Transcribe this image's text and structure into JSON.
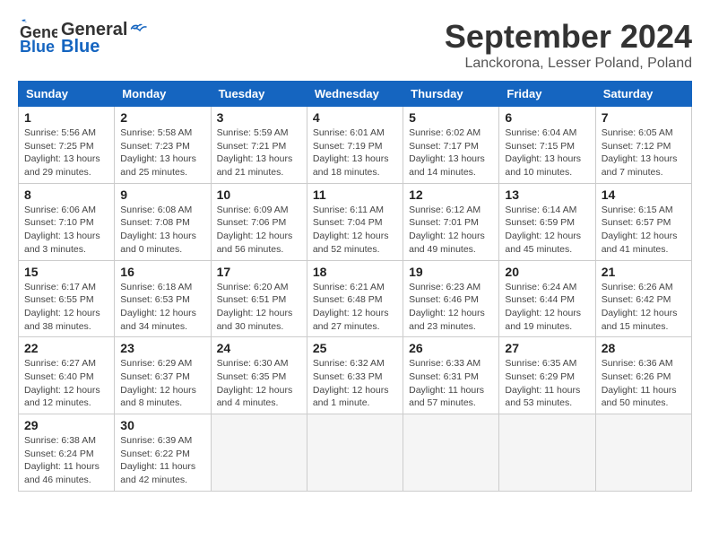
{
  "header": {
    "logo_general": "General",
    "logo_blue": "Blue",
    "month": "September 2024",
    "location": "Lanckorona, Lesser Poland, Poland"
  },
  "weekdays": [
    "Sunday",
    "Monday",
    "Tuesday",
    "Wednesday",
    "Thursday",
    "Friday",
    "Saturday"
  ],
  "weeks": [
    [
      {
        "day": "1",
        "info": "Sunrise: 5:56 AM\nSunset: 7:25 PM\nDaylight: 13 hours\nand 29 minutes."
      },
      {
        "day": "2",
        "info": "Sunrise: 5:58 AM\nSunset: 7:23 PM\nDaylight: 13 hours\nand 25 minutes."
      },
      {
        "day": "3",
        "info": "Sunrise: 5:59 AM\nSunset: 7:21 PM\nDaylight: 13 hours\nand 21 minutes."
      },
      {
        "day": "4",
        "info": "Sunrise: 6:01 AM\nSunset: 7:19 PM\nDaylight: 13 hours\nand 18 minutes."
      },
      {
        "day": "5",
        "info": "Sunrise: 6:02 AM\nSunset: 7:17 PM\nDaylight: 13 hours\nand 14 minutes."
      },
      {
        "day": "6",
        "info": "Sunrise: 6:04 AM\nSunset: 7:15 PM\nDaylight: 13 hours\nand 10 minutes."
      },
      {
        "day": "7",
        "info": "Sunrise: 6:05 AM\nSunset: 7:12 PM\nDaylight: 13 hours\nand 7 minutes."
      }
    ],
    [
      {
        "day": "8",
        "info": "Sunrise: 6:06 AM\nSunset: 7:10 PM\nDaylight: 13 hours\nand 3 minutes."
      },
      {
        "day": "9",
        "info": "Sunrise: 6:08 AM\nSunset: 7:08 PM\nDaylight: 13 hours\nand 0 minutes."
      },
      {
        "day": "10",
        "info": "Sunrise: 6:09 AM\nSunset: 7:06 PM\nDaylight: 12 hours\nand 56 minutes."
      },
      {
        "day": "11",
        "info": "Sunrise: 6:11 AM\nSunset: 7:04 PM\nDaylight: 12 hours\nand 52 minutes."
      },
      {
        "day": "12",
        "info": "Sunrise: 6:12 AM\nSunset: 7:01 PM\nDaylight: 12 hours\nand 49 minutes."
      },
      {
        "day": "13",
        "info": "Sunrise: 6:14 AM\nSunset: 6:59 PM\nDaylight: 12 hours\nand 45 minutes."
      },
      {
        "day": "14",
        "info": "Sunrise: 6:15 AM\nSunset: 6:57 PM\nDaylight: 12 hours\nand 41 minutes."
      }
    ],
    [
      {
        "day": "15",
        "info": "Sunrise: 6:17 AM\nSunset: 6:55 PM\nDaylight: 12 hours\nand 38 minutes."
      },
      {
        "day": "16",
        "info": "Sunrise: 6:18 AM\nSunset: 6:53 PM\nDaylight: 12 hours\nand 34 minutes."
      },
      {
        "day": "17",
        "info": "Sunrise: 6:20 AM\nSunset: 6:51 PM\nDaylight: 12 hours\nand 30 minutes."
      },
      {
        "day": "18",
        "info": "Sunrise: 6:21 AM\nSunset: 6:48 PM\nDaylight: 12 hours\nand 27 minutes."
      },
      {
        "day": "19",
        "info": "Sunrise: 6:23 AM\nSunset: 6:46 PM\nDaylight: 12 hours\nand 23 minutes."
      },
      {
        "day": "20",
        "info": "Sunrise: 6:24 AM\nSunset: 6:44 PM\nDaylight: 12 hours\nand 19 minutes."
      },
      {
        "day": "21",
        "info": "Sunrise: 6:26 AM\nSunset: 6:42 PM\nDaylight: 12 hours\nand 15 minutes."
      }
    ],
    [
      {
        "day": "22",
        "info": "Sunrise: 6:27 AM\nSunset: 6:40 PM\nDaylight: 12 hours\nand 12 minutes."
      },
      {
        "day": "23",
        "info": "Sunrise: 6:29 AM\nSunset: 6:37 PM\nDaylight: 12 hours\nand 8 minutes."
      },
      {
        "day": "24",
        "info": "Sunrise: 6:30 AM\nSunset: 6:35 PM\nDaylight: 12 hours\nand 4 minutes."
      },
      {
        "day": "25",
        "info": "Sunrise: 6:32 AM\nSunset: 6:33 PM\nDaylight: 12 hours\nand 1 minute."
      },
      {
        "day": "26",
        "info": "Sunrise: 6:33 AM\nSunset: 6:31 PM\nDaylight: 11 hours\nand 57 minutes."
      },
      {
        "day": "27",
        "info": "Sunrise: 6:35 AM\nSunset: 6:29 PM\nDaylight: 11 hours\nand 53 minutes."
      },
      {
        "day": "28",
        "info": "Sunrise: 6:36 AM\nSunset: 6:26 PM\nDaylight: 11 hours\nand 50 minutes."
      }
    ],
    [
      {
        "day": "29",
        "info": "Sunrise: 6:38 AM\nSunset: 6:24 PM\nDaylight: 11 hours\nand 46 minutes."
      },
      {
        "day": "30",
        "info": "Sunrise: 6:39 AM\nSunset: 6:22 PM\nDaylight: 11 hours\nand 42 minutes."
      },
      {
        "day": "",
        "info": ""
      },
      {
        "day": "",
        "info": ""
      },
      {
        "day": "",
        "info": ""
      },
      {
        "day": "",
        "info": ""
      },
      {
        "day": "",
        "info": ""
      }
    ]
  ]
}
